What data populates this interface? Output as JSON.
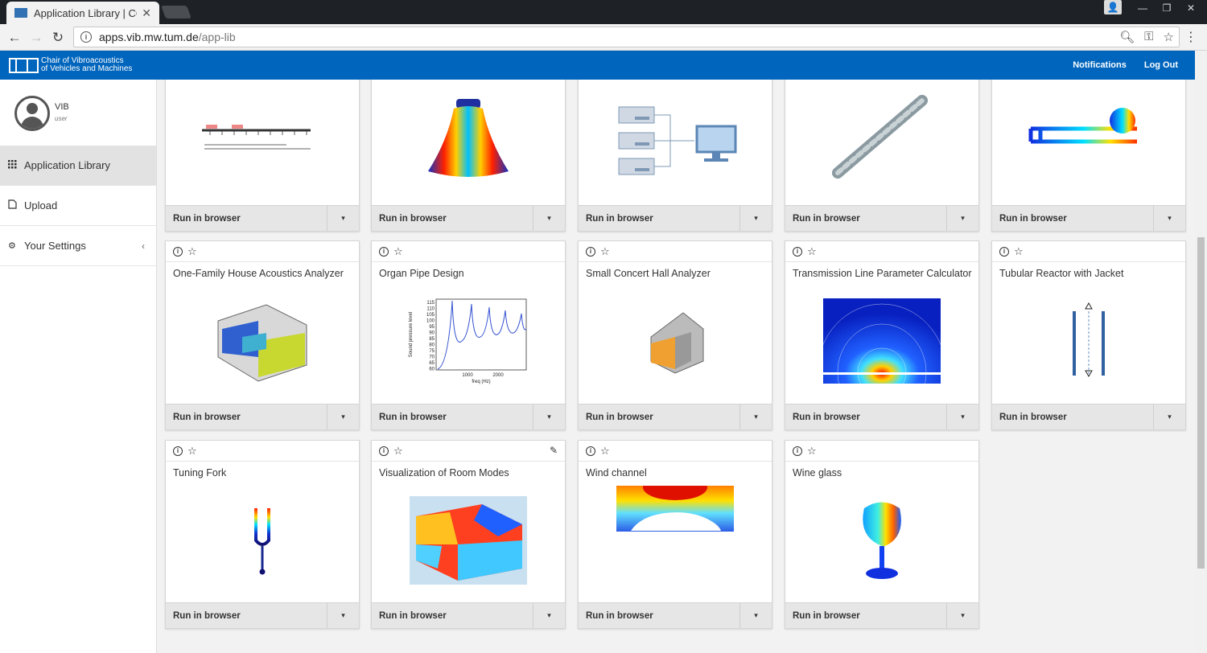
{
  "browser": {
    "tab_title": "Application Library | COM",
    "tab_close": "✕",
    "url_host": "apps.vib.mw.tum.de",
    "url_path": "/app-lib"
  },
  "header": {
    "org_line1": "Chair of Vibroacoustics",
    "org_line2": "of Vehicles and Machines",
    "notifications_label": "Notifications",
    "logout_label": "Log Out"
  },
  "sidebar": {
    "user_name": "VIB",
    "user_role": "user",
    "items": [
      {
        "label": "Application Library",
        "icon": "grid-icon"
      },
      {
        "label": "Upload",
        "icon": "upload-file-icon"
      },
      {
        "label": "Your Settings",
        "icon": "gear-icon"
      }
    ]
  },
  "cards": {
    "run_label": "Run in browser",
    "row1": [
      "",
      "",
      "",
      "",
      ""
    ],
    "row2": [
      "One-Family House Acoustics Analyzer",
      "Organ Pipe Design",
      "Small Concert Hall Analyzer",
      "Transmission Line Parameter Calculator",
      "Tubular Reactor with Jacket"
    ],
    "row3": [
      "Tuning Fork",
      "Visualization of Room Modes",
      "Wind channel",
      "Wine glass"
    ]
  },
  "organ_plot": {
    "ylabel": "Sound pressure level",
    "xlabel": "freq (Hz)",
    "yticks": [
      "115",
      "110",
      "105",
      "100",
      "95",
      "90",
      "85",
      "80",
      "75",
      "70",
      "65",
      "60"
    ],
    "xticks": [
      "1000",
      "2000"
    ]
  }
}
